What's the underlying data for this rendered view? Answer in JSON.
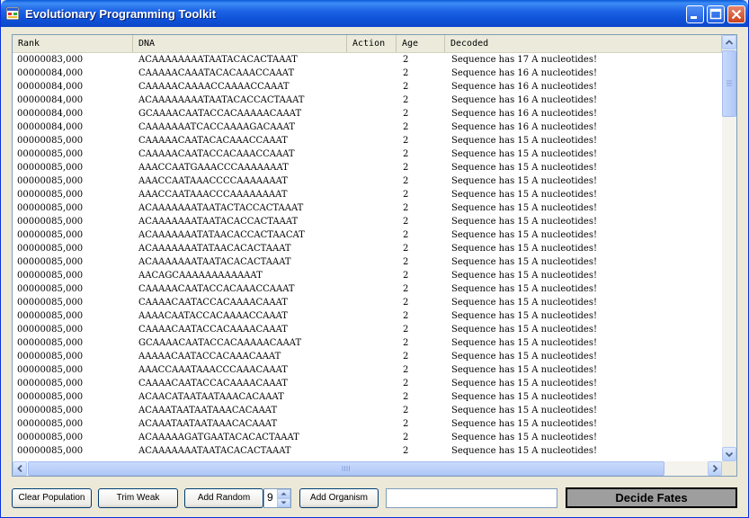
{
  "window": {
    "title": "Evolutionary Programming Toolkit"
  },
  "columns": [
    {
      "label": "Rank"
    },
    {
      "label": "DNA"
    },
    {
      "label": "Action"
    },
    {
      "label": "Age"
    },
    {
      "label": "Decoded"
    }
  ],
  "rows": [
    {
      "rank": "00000083,000",
      "dna": "ACAAAAAAAATAATACACACTAAAT",
      "action": "",
      "age": "2",
      "decoded": "Sequence has 17 A nucleotides!"
    },
    {
      "rank": "00000084,000",
      "dna": "CAAAAACAAATACACAAACCAAAT",
      "action": "",
      "age": "2",
      "decoded": "Sequence has 16 A nucleotides!"
    },
    {
      "rank": "00000084,000",
      "dna": "CAAAAACAAAACCAAAACCAAAT",
      "action": "",
      "age": "2",
      "decoded": "Sequence has 16 A nucleotides!"
    },
    {
      "rank": "00000084,000",
      "dna": "ACAAAAAAAATAATACACCACTAAAT",
      "action": "",
      "age": "2",
      "decoded": "Sequence has 16 A nucleotides!"
    },
    {
      "rank": "00000084,000",
      "dna": "GCAAAACAATACCACAAAAACAAAT",
      "action": "",
      "age": "2",
      "decoded": "Sequence has 16 A nucleotides!"
    },
    {
      "rank": "00000084,000",
      "dna": "CAAAAAAATCACCAAAAGACAAAT",
      "action": "",
      "age": "2",
      "decoded": "Sequence has 16 A nucleotides!"
    },
    {
      "rank": "00000085,000",
      "dna": "CAAAAACAATACACAAACCAAAT",
      "action": "",
      "age": "2",
      "decoded": "Sequence has 15 A nucleotides!"
    },
    {
      "rank": "00000085,000",
      "dna": "CAAAAACAATACCACAAACCAAAT",
      "action": "",
      "age": "2",
      "decoded": "Sequence has 15 A nucleotides!"
    },
    {
      "rank": "00000085,000",
      "dna": "AAACCAATGAAACCCAAAAAAAT",
      "action": "",
      "age": "2",
      "decoded": "Sequence has 15 A nucleotides!"
    },
    {
      "rank": "00000085,000",
      "dna": "AAACCAATAAACCCCAAAAAAAT",
      "action": "",
      "age": "2",
      "decoded": "Sequence has 15 A nucleotides!"
    },
    {
      "rank": "00000085,000",
      "dna": "AAACCAATAAACCCAAAAAAAAT",
      "action": "",
      "age": "2",
      "decoded": "Sequence has 15 A nucleotides!"
    },
    {
      "rank": "00000085,000",
      "dna": "ACAAAAAAATAATACTACCACTAAAT",
      "action": "",
      "age": "2",
      "decoded": "Sequence has 15 A nucleotides!"
    },
    {
      "rank": "00000085,000",
      "dna": "ACAAAAAAATAATACACCACTAAAT",
      "action": "",
      "age": "2",
      "decoded": "Sequence has 15 A nucleotides!"
    },
    {
      "rank": "00000085,000",
      "dna": "ACAAAAAAATATAACACCACTAACAT",
      "action": "",
      "age": "2",
      "decoded": "Sequence has 15 A nucleotides!"
    },
    {
      "rank": "00000085,000",
      "dna": "ACAAAAAAATATAACACACTAAAT",
      "action": "",
      "age": "2",
      "decoded": "Sequence has 15 A nucleotides!"
    },
    {
      "rank": "00000085,000",
      "dna": "ACAAAAAAATAATACACACTAAAT",
      "action": "",
      "age": "2",
      "decoded": "Sequence has 15 A nucleotides!"
    },
    {
      "rank": "00000085,000",
      "dna": "AACAGCAAAAAAAAAAAAT",
      "action": "",
      "age": "2",
      "decoded": "Sequence has 15 A nucleotides!"
    },
    {
      "rank": "00000085,000",
      "dna": "CAAAAACAATACCACAAACCAAAT",
      "action": "",
      "age": "2",
      "decoded": "Sequence has 15 A nucleotides!"
    },
    {
      "rank": "00000085,000",
      "dna": "CAAAACAATACCACAAAACAAAT",
      "action": "",
      "age": "2",
      "decoded": "Sequence has 15 A nucleotides!"
    },
    {
      "rank": "00000085,000",
      "dna": "AAAACAATACCACAAAACCAAAT",
      "action": "",
      "age": "2",
      "decoded": "Sequence has 15 A nucleotides!"
    },
    {
      "rank": "00000085,000",
      "dna": "CAAAACAATACCACAAAACAAAT",
      "action": "",
      "age": "2",
      "decoded": "Sequence has 15 A nucleotides!"
    },
    {
      "rank": "00000085,000",
      "dna": "GCAAAACAATACCACAAAAACAAAT",
      "action": "",
      "age": "2",
      "decoded": "Sequence has 15 A nucleotides!"
    },
    {
      "rank": "00000085,000",
      "dna": "AAAAACAATACCACAAACAAAT",
      "action": "",
      "age": "2",
      "decoded": "Sequence has 15 A nucleotides!"
    },
    {
      "rank": "00000085,000",
      "dna": "AAACCAAATAAACCCAAACAAAT",
      "action": "",
      "age": "2",
      "decoded": "Sequence has 15 A nucleotides!"
    },
    {
      "rank": "00000085,000",
      "dna": "CAAAACAATACCACAAAACAAAT",
      "action": "",
      "age": "2",
      "decoded": "Sequence has 15 A nucleotides!"
    },
    {
      "rank": "00000085,000",
      "dna": "ACAACATAATAATAAACACAAAT",
      "action": "",
      "age": "2",
      "decoded": "Sequence has 15 A nucleotides!"
    },
    {
      "rank": "00000085,000",
      "dna": "ACAAATAATAATAAACACAAAT",
      "action": "",
      "age": "2",
      "decoded": "Sequence has 15 A nucleotides!"
    },
    {
      "rank": "00000085,000",
      "dna": "ACAAATAATAATAAACACAAAT",
      "action": "",
      "age": "2",
      "decoded": "Sequence has 15 A nucleotides!"
    },
    {
      "rank": "00000085,000",
      "dna": "ACAAAAAGATGAATACACACTAAAT",
      "action": "",
      "age": "2",
      "decoded": "Sequence has 15 A nucleotides!"
    },
    {
      "rank": "00000085,000",
      "dna": "ACAAAAAAATAATACACACTAAAT",
      "action": "",
      "age": "2",
      "decoded": "Sequence has 15 A nucleotides!"
    }
  ],
  "toolbar": {
    "clear_label": "Clear Population",
    "trim_label": "Trim Weak",
    "add_random_label": "Add Random",
    "spinner_value": "9",
    "add_organism_label": "Add Organism",
    "input_value": "",
    "decide_label": "Decide Fates"
  },
  "colors": {
    "titlebar": "#0c48c8",
    "face": "#ece9d8",
    "decide_button": "#9e9e9e"
  },
  "icons": {
    "app": "app-window-icon",
    "minimize": "minimize-icon",
    "maximize": "maximize-icon",
    "close": "close-icon"
  }
}
